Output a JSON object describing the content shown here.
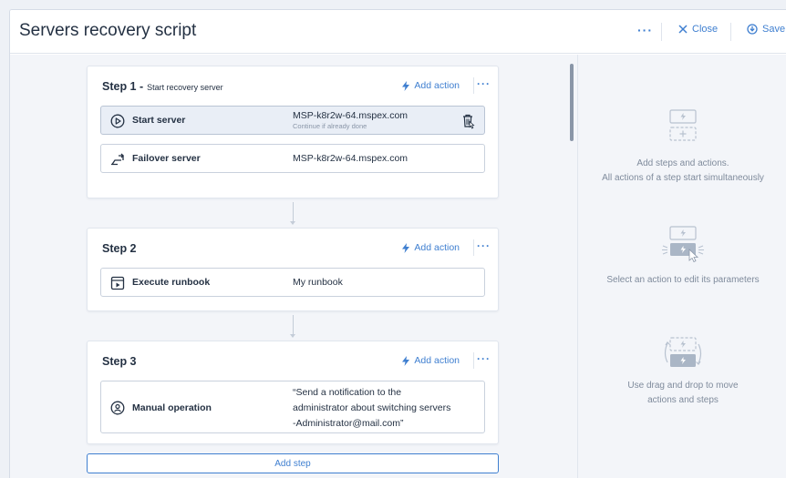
{
  "header": {
    "title": "Servers recovery script",
    "more_label": "···",
    "close_label": "Close",
    "save_label": "Save"
  },
  "steps": [
    {
      "title": "Step 1 -",
      "subtitle": "Start recovery server",
      "add_action_label": "Add action",
      "more_label": "···",
      "actions": [
        {
          "name": "Start server",
          "value": "MSP-k8r2w-64.mspex.com",
          "note": "Continue if already done",
          "icon": "play-circle-icon",
          "selected": true
        },
        {
          "name": "Failover server",
          "value": "MSP-k8r2w-64.mspex.com",
          "icon": "failover-icon"
        }
      ]
    },
    {
      "title": "Step 2",
      "add_action_label": "Add action",
      "more_label": "···",
      "actions": [
        {
          "name": "Execute runbook",
          "value": "My runbook",
          "icon": "runbook-icon"
        }
      ]
    },
    {
      "title": "Step 3",
      "add_action_label": "Add action",
      "more_label": "···",
      "actions": [
        {
          "name": "Manual operation",
          "value_lines": [
            "“Send a notification to the",
            "administrator about switching servers",
            "-Administrator@mail.com”"
          ],
          "icon": "manual-operation-icon"
        }
      ]
    }
  ],
  "add_step_label": "Add step",
  "hints": [
    {
      "line1": "Add steps and actions.",
      "line2": "All actions of a step start simultaneously",
      "icon": "add-step-illustration-icon"
    },
    {
      "line1": "Select an action to edit its parameters",
      "icon": "select-action-illustration-icon"
    },
    {
      "line1": "Use drag and drop to move",
      "line2": "actions and steps",
      "icon": "drag-drop-illustration-icon"
    }
  ],
  "colors": {
    "accent": "#3f7fd0",
    "text": "#243143",
    "muted": "#7f8b9c",
    "panel": "#f3f5f9",
    "border": "#c9d1dd"
  }
}
